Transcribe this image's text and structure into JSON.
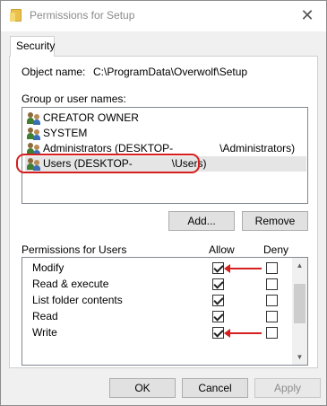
{
  "window": {
    "title": "Permissions for Setup",
    "close_glyph": "✕"
  },
  "tab": {
    "label": "Security"
  },
  "object": {
    "label": "Object name:",
    "value": "C:\\ProgramData\\Overwolf\\Setup"
  },
  "groups": {
    "label": "Group or user names:",
    "items": [
      {
        "label": "CREATOR OWNER",
        "icon": "users-icon"
      },
      {
        "label": "SYSTEM",
        "icon": "users-icon"
      },
      {
        "prefix": "Administrators (DESKTOP-",
        "suffix": "\\Administrators)",
        "icon": "users-icon"
      },
      {
        "prefix": "Users (DESKTOP-",
        "suffix": "\\Users)",
        "icon": "users-icon",
        "selected": true
      }
    ]
  },
  "buttons": {
    "add": "Add...",
    "remove": "Remove",
    "ok": "OK",
    "cancel": "Cancel",
    "apply": "Apply"
  },
  "permissions": {
    "label": "Permissions for Users",
    "allow_header": "Allow",
    "deny_header": "Deny",
    "rows": [
      {
        "label": "Modify",
        "allow": true,
        "deny": false
      },
      {
        "label": "Read & execute",
        "allow": true,
        "deny": false
      },
      {
        "label": "List folder contents",
        "allow": true,
        "deny": false
      },
      {
        "label": "Read",
        "allow": true,
        "deny": false
      },
      {
        "label": "Write",
        "allow": true,
        "deny": false
      }
    ]
  },
  "colors": {
    "annotation_red": "#d61f1f",
    "selection_gray": "#e5e5e5"
  }
}
